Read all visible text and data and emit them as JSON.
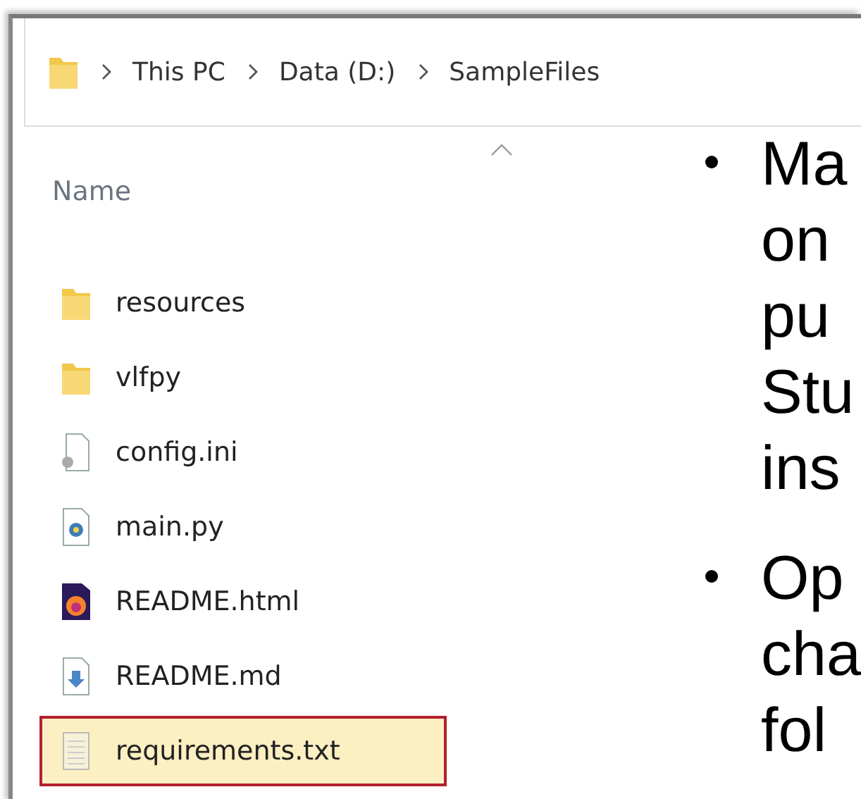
{
  "breadcrumb": [
    "This PC",
    "Data (D:)",
    "SampleFiles"
  ],
  "column_header": {
    "label": "Name",
    "sort_ascending": true
  },
  "files": [
    {
      "name": "resources",
      "kind": "folder",
      "selected": false
    },
    {
      "name": "vlfpy",
      "kind": "folder",
      "selected": false
    },
    {
      "name": "config.ini",
      "kind": "config",
      "selected": false
    },
    {
      "name": "main.py",
      "kind": "python",
      "selected": false
    },
    {
      "name": "README.html",
      "kind": "html",
      "selected": false
    },
    {
      "name": "README.md",
      "kind": "markdown",
      "selected": false
    },
    {
      "name": "requirements.txt",
      "kind": "text",
      "selected": true
    }
  ],
  "bullets": [
    {
      "lines": [
        "Ma",
        "on",
        "pu",
        "Stu",
        "ins"
      ]
    },
    {
      "lines": [
        "Op",
        "cha",
        "fol"
      ]
    }
  ]
}
